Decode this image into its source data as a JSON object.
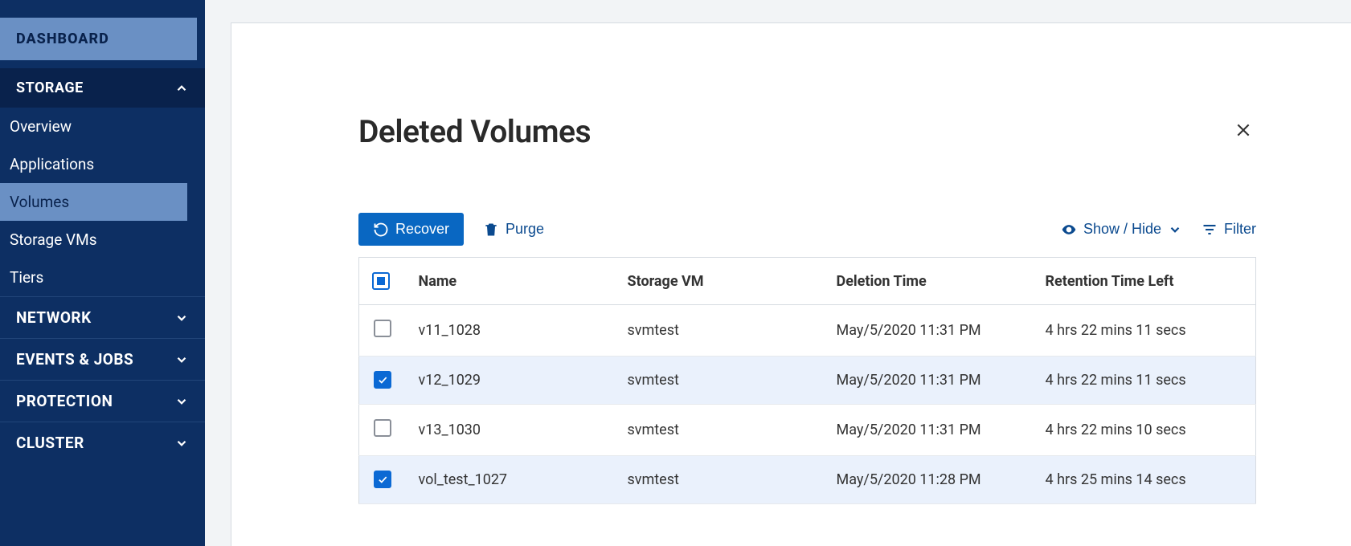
{
  "sidebar": {
    "dashboard": "DASHBOARD",
    "storage": {
      "label": "STORAGE",
      "items": {
        "overview": "Overview",
        "applications": "Applications",
        "volumes": "Volumes",
        "storage_vms": "Storage VMs",
        "tiers": "Tiers"
      }
    },
    "network": "NETWORK",
    "events_jobs": "EVENTS & JOBS",
    "protection": "PROTECTION",
    "cluster": "CLUSTER"
  },
  "panel": {
    "title": "Deleted Volumes"
  },
  "toolbar": {
    "recover": "Recover",
    "purge": "Purge",
    "show_hide": "Show / Hide",
    "filter": "Filter"
  },
  "table": {
    "headers": {
      "name": "Name",
      "svm": "Storage VM",
      "deletion_time": "Deletion Time",
      "retention": "Retention Time Left"
    },
    "rows": [
      {
        "checked": false,
        "name": "v11_1028",
        "svm": "svmtest",
        "deletion_time": "May/5/2020 11:31 PM",
        "retention": "4 hrs 22 mins 11 secs"
      },
      {
        "checked": true,
        "name": "v12_1029",
        "svm": "svmtest",
        "deletion_time": "May/5/2020 11:31 PM",
        "retention": "4 hrs 22 mins 11 secs"
      },
      {
        "checked": false,
        "name": "v13_1030",
        "svm": "svmtest",
        "deletion_time": "May/5/2020 11:31 PM",
        "retention": "4 hrs 22 mins 10 secs"
      },
      {
        "checked": true,
        "name": "vol_test_1027",
        "svm": "svmtest",
        "deletion_time": "May/5/2020 11:28 PM",
        "retention": "4 hrs 25 mins 14 secs"
      }
    ]
  }
}
